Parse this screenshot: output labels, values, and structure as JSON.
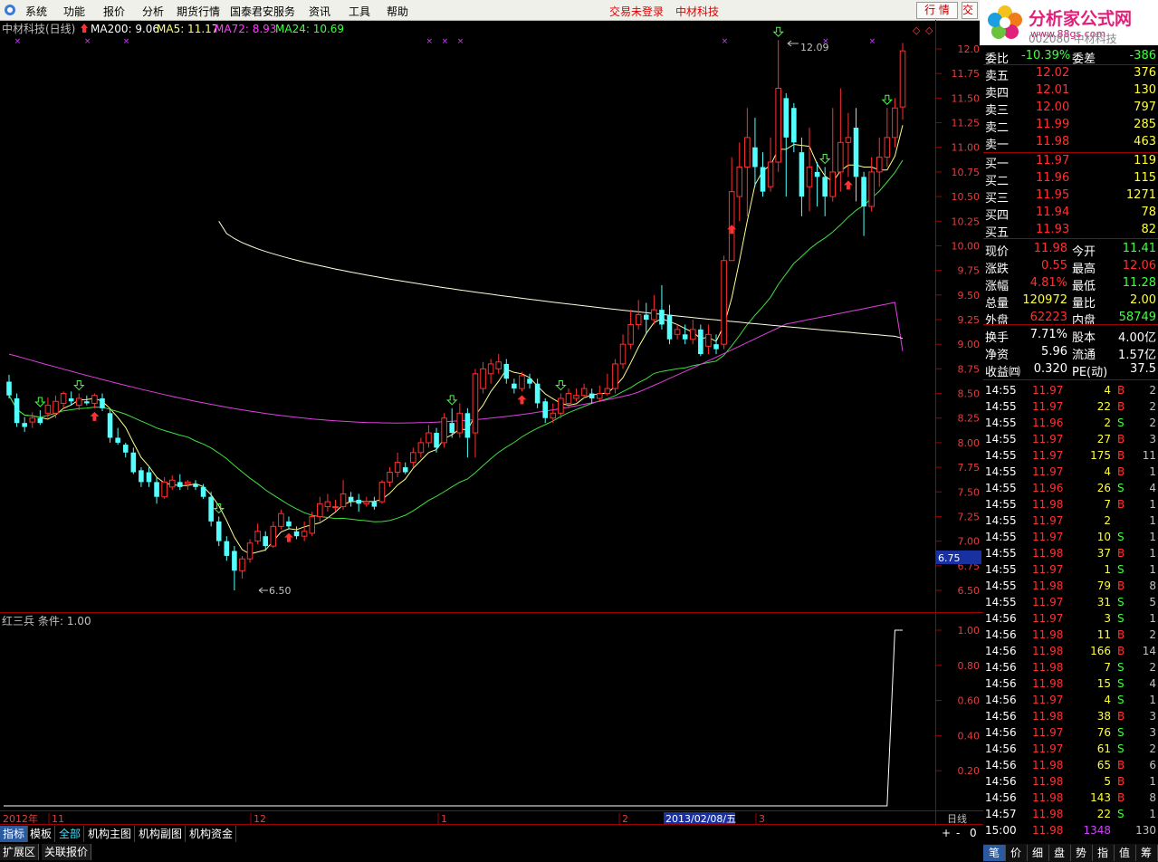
{
  "menu": {
    "items": [
      "系统",
      "功能",
      "报价",
      "分析",
      "期货行情",
      "国泰君安服务",
      "资讯",
      "工具",
      "帮助"
    ],
    "trade_status": "交易未登录",
    "stock_name": "中材科技",
    "quote_button": "行 情",
    "trade_button": "交易"
  },
  "logo": {
    "title": "分析家公式网",
    "url": "www.88gs.com"
  },
  "chart_title": {
    "name": "中材科技(日线)",
    "ma200": "MA200: 9.06",
    "ma5": "MA5: 11.17",
    "ma72": "MA72: 8.93",
    "ma24": "MA24: 10.69"
  },
  "indicator": {
    "title": "红三兵",
    "condition": "条件: 1.00"
  },
  "price_axis_labels": [
    "12.0",
    "11.75",
    "11.50",
    "11.25",
    "11.00",
    "10.75",
    "10.50",
    "10.25",
    "10.00",
    "9.75",
    "9.50",
    "9.25",
    "9.00",
    "8.75",
    "8.50",
    "8.25",
    "8.00",
    "7.75",
    "7.50",
    "7.25",
    "7.00",
    "6.75",
    "6.50"
  ],
  "indicator_axis_labels": [
    "1.00",
    "0.80",
    "0.60",
    "0.40",
    "0.20"
  ],
  "cursor_price": "6.75",
  "annotations": {
    "high": "12.09",
    "low": "6.50"
  },
  "date_axis": {
    "labels": [
      "2012年",
      "11",
      "12",
      "1",
      "2",
      "3"
    ],
    "cursor_date": "2013/02/08/五",
    "period": "日线"
  },
  "bottom_tabs": [
    "指标",
    "模板",
    "全部",
    "机构主图",
    "机构副图",
    "机构资金"
  ],
  "bottom_tabs2": [
    "扩展区",
    "关联报价"
  ],
  "zoom_buttons": [
    "+",
    "-",
    "0"
  ],
  "right_tabs": [
    "笔",
    "价",
    "细",
    "盘",
    "势",
    "指",
    "值",
    "筹"
  ],
  "stock_code": "002080 中材科技",
  "wei": {
    "wb_label": "委比",
    "wb_value": "-10.39%",
    "wc_label": "委差",
    "wc_value": "-386"
  },
  "asks": [
    {
      "label": "卖五",
      "price": "12.02",
      "vol": "376"
    },
    {
      "label": "卖四",
      "price": "12.01",
      "vol": "130"
    },
    {
      "label": "卖三",
      "price": "12.00",
      "vol": "797"
    },
    {
      "label": "卖二",
      "price": "11.99",
      "vol": "285"
    },
    {
      "label": "卖一",
      "price": "11.98",
      "vol": "463"
    }
  ],
  "bids": [
    {
      "label": "买一",
      "price": "11.97",
      "vol": "119"
    },
    {
      "label": "买二",
      "price": "11.96",
      "vol": "115"
    },
    {
      "label": "买三",
      "price": "11.95",
      "vol": "1271"
    },
    {
      "label": "买四",
      "price": "11.94",
      "vol": "78"
    },
    {
      "label": "买五",
      "price": "11.93",
      "vol": "82"
    }
  ],
  "stats": [
    {
      "l1": "现价",
      "v1": "11.98",
      "l2": "今开",
      "v2": "11.41"
    },
    {
      "l1": "涨跌",
      "v1": "0.55",
      "l2": "最高",
      "v2": "12.06"
    },
    {
      "l1": "涨幅",
      "v1": "4.81%",
      "l2": "最低",
      "v2": "11.28"
    },
    {
      "l1": "总量",
      "v1": "120972",
      "l2": "量比",
      "v2": "2.00"
    },
    {
      "l1": "外盘",
      "v1": "62223",
      "l2": "内盘",
      "v2": "58749"
    }
  ],
  "stats2": [
    {
      "l1": "换手",
      "v1": "7.71%",
      "l2": "股本",
      "v2": "4.00亿"
    },
    {
      "l1": "净资",
      "v1": "5.96",
      "l2": "流通",
      "v2": "1.57亿"
    },
    {
      "l1": "收益㈣",
      "v1": "0.320",
      "l2": "PE(动)",
      "v2": "37.5"
    }
  ],
  "ticks": [
    [
      "14:55",
      "11.97",
      "4",
      "B",
      "2"
    ],
    [
      "14:55",
      "11.97",
      "22",
      "B",
      "2"
    ],
    [
      "14:55",
      "11.96",
      "2",
      "S",
      "2"
    ],
    [
      "14:55",
      "11.97",
      "27",
      "B",
      "3"
    ],
    [
      "14:55",
      "11.97",
      "175",
      "B",
      "11"
    ],
    [
      "14:55",
      "11.97",
      "4",
      "B",
      "1"
    ],
    [
      "14:55",
      "11.96",
      "26",
      "S",
      "4"
    ],
    [
      "14:55",
      "11.98",
      "7",
      "B",
      "1"
    ],
    [
      "14:55",
      "11.97",
      "2",
      "",
      "1"
    ],
    [
      "14:55",
      "11.97",
      "10",
      "S",
      "1"
    ],
    [
      "14:55",
      "11.98",
      "37",
      "B",
      "1"
    ],
    [
      "14:55",
      "11.97",
      "1",
      "S",
      "1"
    ],
    [
      "14:55",
      "11.98",
      "79",
      "B",
      "8"
    ],
    [
      "14:55",
      "11.97",
      "31",
      "S",
      "5"
    ],
    [
      "14:56",
      "11.97",
      "3",
      "S",
      "1"
    ],
    [
      "14:56",
      "11.98",
      "11",
      "B",
      "2"
    ],
    [
      "14:56",
      "11.98",
      "166",
      "B",
      "14"
    ],
    [
      "14:56",
      "11.98",
      "7",
      "S",
      "2"
    ],
    [
      "14:56",
      "11.98",
      "15",
      "S",
      "4"
    ],
    [
      "14:56",
      "11.97",
      "4",
      "S",
      "1"
    ],
    [
      "14:56",
      "11.98",
      "38",
      "B",
      "3"
    ],
    [
      "14:56",
      "11.97",
      "76",
      "S",
      "3"
    ],
    [
      "14:56",
      "11.97",
      "61",
      "S",
      "2"
    ],
    [
      "14:56",
      "11.98",
      "65",
      "B",
      "6"
    ],
    [
      "14:56",
      "11.98",
      "5",
      "B",
      "1"
    ],
    [
      "14:56",
      "11.98",
      "143",
      "B",
      "8"
    ],
    [
      "14:57",
      "11.98",
      "22",
      "S",
      "1"
    ],
    [
      "15:00",
      "11.98",
      "1348",
      "",
      "130"
    ]
  ],
  "chart_data": {
    "type": "candlestick",
    "candles": [
      [
        8.62,
        8.48,
        8.69,
        8.45
      ],
      [
        8.45,
        8.2,
        8.5,
        8.16
      ],
      [
        8.2,
        8.16,
        8.26,
        8.11
      ],
      [
        8.21,
        8.25,
        8.31,
        8.15
      ],
      [
        8.25,
        8.2,
        8.33,
        8.18
      ],
      [
        8.3,
        8.38,
        8.46,
        8.25
      ],
      [
        8.3,
        8.42,
        8.48,
        8.25
      ],
      [
        8.4,
        8.5,
        8.52,
        8.35
      ],
      [
        8.45,
        8.42,
        8.52,
        8.38
      ],
      [
        8.38,
        8.45,
        8.5,
        8.33
      ],
      [
        8.42,
        8.4,
        8.48,
        8.38
      ],
      [
        8.4,
        8.48,
        8.5,
        8.35
      ],
      [
        8.45,
        8.35,
        8.5,
        8.32
      ],
      [
        8.3,
        8.05,
        8.35,
        8.0
      ],
      [
        8.05,
        8.0,
        8.15,
        7.98
      ],
      [
        7.98,
        7.9,
        8.0,
        7.85
      ],
      [
        7.9,
        7.7,
        7.95,
        7.68
      ],
      [
        7.72,
        7.6,
        7.75,
        7.55
      ],
      [
        7.7,
        7.6,
        7.75,
        7.55
      ],
      [
        7.6,
        7.45,
        7.65,
        7.38
      ],
      [
        7.45,
        7.6,
        7.65,
        7.43
      ],
      [
        7.55,
        7.62,
        7.67,
        7.52
      ],
      [
        7.6,
        7.55,
        7.68,
        7.52
      ],
      [
        7.58,
        7.6,
        7.62,
        7.52
      ],
      [
        7.58,
        7.55,
        7.62,
        7.52
      ],
      [
        7.55,
        7.45,
        7.58,
        7.43
      ],
      [
        7.45,
        7.2,
        7.5,
        7.15
      ],
      [
        7.2,
        7.0,
        7.25,
        6.95
      ],
      [
        7.0,
        6.85,
        7.05,
        6.8
      ],
      [
        6.9,
        6.7,
        6.95,
        6.5
      ],
      [
        6.7,
        6.82,
        6.85,
        6.62
      ],
      [
        6.82,
        6.98,
        7.02,
        6.78
      ],
      [
        7.0,
        7.1,
        7.18,
        6.97
      ],
      [
        7.05,
        6.95,
        7.1,
        6.9
      ],
      [
        6.95,
        7.15,
        7.2,
        6.93
      ],
      [
        7.15,
        7.28,
        7.32,
        7.12
      ],
      [
        7.2,
        7.15,
        7.25,
        7.12
      ],
      [
        7.1,
        7.05,
        7.15,
        7.02
      ],
      [
        7.05,
        7.1,
        7.2,
        7.0
      ],
      [
        7.08,
        7.25,
        7.3,
        7.05
      ],
      [
        7.25,
        7.38,
        7.45,
        7.2
      ],
      [
        7.35,
        7.4,
        7.48,
        7.3
      ],
      [
        7.35,
        7.35,
        7.42,
        7.3
      ],
      [
        7.35,
        7.48,
        7.62,
        7.32
      ],
      [
        7.45,
        7.4,
        7.5,
        7.35
      ],
      [
        7.42,
        7.38,
        7.48,
        7.3
      ],
      [
        7.38,
        7.4,
        7.45,
        7.35
      ],
      [
        7.4,
        7.35,
        7.45,
        7.32
      ],
      [
        7.4,
        7.6,
        7.62,
        7.38
      ],
      [
        7.6,
        7.7,
        7.75,
        7.55
      ],
      [
        7.7,
        7.8,
        7.9,
        7.65
      ],
      [
        7.75,
        7.7,
        7.8,
        7.68
      ],
      [
        7.8,
        7.9,
        7.95,
        7.75
      ],
      [
        7.9,
        8.0,
        8.05,
        7.85
      ],
      [
        8.0,
        8.1,
        8.18,
        7.95
      ],
      [
        8.1,
        7.95,
        8.15,
        7.9
      ],
      [
        8.0,
        8.25,
        8.3,
        7.95
      ],
      [
        8.2,
        8.1,
        8.35,
        8.05
      ],
      [
        8.1,
        8.3,
        8.4,
        8.05
      ],
      [
        8.3,
        8.05,
        8.35,
        7.85
      ],
      [
        8.1,
        8.7,
        8.75,
        7.85
      ],
      [
        8.55,
        8.75,
        8.82,
        8.5
      ],
      [
        8.7,
        8.8,
        8.85,
        8.6
      ],
      [
        8.75,
        8.82,
        8.9,
        8.7
      ],
      [
        8.8,
        8.65,
        8.85,
        8.6
      ],
      [
        8.6,
        8.55,
        8.65,
        8.5
      ],
      [
        8.55,
        8.68,
        8.72,
        8.52
      ],
      [
        8.65,
        8.6,
        8.7,
        8.55
      ],
      [
        8.6,
        8.4,
        8.65,
        8.35
      ],
      [
        8.42,
        8.25,
        8.45,
        8.2
      ],
      [
        8.25,
        8.3,
        8.4,
        8.2
      ],
      [
        8.3,
        8.45,
        8.5,
        8.25
      ],
      [
        8.4,
        8.5,
        8.55,
        8.35
      ],
      [
        8.45,
        8.48,
        8.55,
        8.42
      ],
      [
        8.48,
        8.55,
        8.6,
        8.45
      ],
      [
        8.5,
        8.45,
        8.55,
        8.4
      ],
      [
        8.45,
        8.5,
        8.58,
        8.42
      ],
      [
        8.5,
        8.55,
        8.7,
        8.48
      ],
      [
        8.55,
        8.8,
        8.85,
        8.5
      ],
      [
        8.8,
        9.0,
        9.1,
        8.75
      ],
      [
        9.0,
        9.2,
        9.35,
        8.95
      ],
      [
        9.2,
        9.3,
        9.45,
        9.15
      ],
      [
        9.3,
        9.25,
        9.42,
        9.1
      ],
      [
        9.25,
        9.35,
        9.5,
        9.2
      ],
      [
        9.35,
        9.2,
        9.6,
        9.15
      ],
      [
        9.3,
        9.05,
        9.4,
        9.0
      ],
      [
        9.1,
        9.15,
        9.2,
        9.05
      ],
      [
        9.1,
        9.05,
        9.2,
        9.0
      ],
      [
        9.05,
        9.15,
        9.25,
        9.0
      ],
      [
        9.15,
        8.9,
        9.2,
        8.88
      ],
      [
        8.98,
        9.1,
        9.2,
        8.9
      ],
      [
        9.0,
        8.95,
        9.1,
        8.9
      ],
      [
        9.0,
        9.85,
        9.9,
        8.95
      ],
      [
        9.85,
        10.55,
        10.9,
        10.25
      ],
      [
        10.5,
        10.8,
        11.05,
        10.25
      ],
      [
        10.8,
        11.1,
        11.4,
        10.3
      ],
      [
        11.0,
        10.8,
        11.3,
        10.6
      ],
      [
        10.8,
        10.55,
        10.95,
        10.5
      ],
      [
        10.6,
        10.85,
        11.1,
        10.55
      ],
      [
        10.85,
        11.6,
        12.09,
        10.75
      ],
      [
        11.5,
        11.1,
        11.55,
        10.5
      ],
      [
        11.4,
        11.05,
        11.45,
        10.95
      ],
      [
        10.95,
        10.5,
        11.1,
        10.3
      ],
      [
        10.6,
        10.8,
        11.2,
        10.35
      ],
      [
        10.75,
        10.7,
        10.85,
        10.4
      ],
      [
        10.7,
        10.5,
        10.8,
        10.3
      ],
      [
        10.5,
        10.75,
        11.4,
        10.45
      ],
      [
        10.75,
        11.05,
        11.6,
        10.55
      ],
      [
        11.05,
        11.1,
        11.35,
        10.7
      ],
      [
        11.2,
        10.7,
        11.4,
        10.45
      ],
      [
        10.7,
        10.4,
        10.75,
        10.1
      ],
      [
        10.4,
        10.75,
        10.9,
        10.35
      ],
      [
        10.75,
        10.9,
        11.1,
        10.6
      ],
      [
        10.9,
        11.1,
        11.4,
        10.8
      ],
      [
        11.1,
        11.4,
        11.5,
        11.0
      ],
      [
        11.41,
        11.98,
        12.06,
        11.28
      ]
    ],
    "ma_values": {
      "MA200": 9.06,
      "MA5": 11.17,
      "MA72": 8.93,
      "MA24": 10.69
    },
    "indicator": {
      "name": "红三兵",
      "values": [
        0,
        1
      ]
    },
    "high_mark": 12.09,
    "low_mark": 6.5,
    "colors": {
      "up": "#ff3030",
      "down": "#54ffff",
      "ma5": "#ffff90",
      "ma24": "#40e040",
      "ma72": "#e040e0",
      "ma200": "#ffffe0"
    }
  }
}
